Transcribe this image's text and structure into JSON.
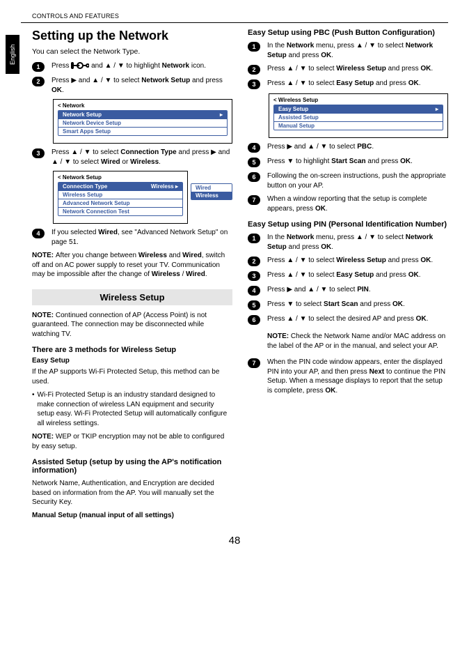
{
  "header": "CONTROLS AND FEATURES",
  "lang": "English",
  "page_number": "48",
  "left": {
    "title": "Setting up the Network",
    "intro": "You can select the Network Type.",
    "step1_a": "Press ",
    "step1_b": " and ▲ / ▼ to highlight ",
    "step1_bold1": "Network",
    "step1_c": " icon.",
    "step2_a": "Press ▶ and ▲ / ▼ to select ",
    "step2_bold1": "Network Setup",
    "step2_b": " and press ",
    "step2_bold2": "OK",
    "step2_c": ".",
    "menu1_title": "< Network",
    "menu1_row1": "Network Setup",
    "menu1_row2": "Network Device Setup",
    "menu1_row3": "Smart Apps Setup",
    "step3_a": "Press ▲ / ▼ to select ",
    "step3_bold1": "Connection Type",
    "step3_b": " and press ▶ and ▲ / ▼ to select ",
    "step3_bold2": "Wired",
    "step3_c": " or ",
    "step3_bold3": "Wireless",
    "step3_d": ".",
    "menu2_title": "< Network Setup",
    "menu2_row1_label": "Connection Type",
    "menu2_row1_value": "Wireless",
    "menu2_row2": "Wireless Setup",
    "menu2_row3": "Advanced Network Setup",
    "menu2_row4": "Network Connection Test",
    "popup_row1": "Wired",
    "popup_row2": "Wireless",
    "step4_a": "If you selected ",
    "step4_bold1": "Wired",
    "step4_b": ", see \"Advanced Network Setup\" on page 51.",
    "note1_label": "NOTE:  ",
    "note1_a": "After you change between ",
    "note1_bold1": "Wireless",
    "note1_b": " and ",
    "note1_bold2": "Wired",
    "note1_c": ", switch off and on AC power supply to reset your TV. Communication may be impossible after the change of ",
    "note1_bold3": "Wireless",
    "note1_d": " / ",
    "note1_bold4": "Wired",
    "note1_e": ".",
    "wireless_head": "Wireless Setup",
    "note2_label": "NOTE:",
    "note2_text": " Continued connection of AP (Access Point) is not guaranteed. The connection may be disconnected while watching TV.",
    "methods_head": "There are 3 methods for Wireless Setup",
    "easy_label": "Easy Setup",
    "easy_text": "If the AP supports Wi-Fi Protected Setup, this method can be used.",
    "easy_bullet": "Wi-Fi Protected Setup is an industry standard designed to make connection of wireless LAN equipment and security setup easy. Wi-Fi Protected Setup will automatically configure all wireless settings.",
    "note3_label": "NOTE:  ",
    "note3_text": "WEP or TKIP encryption may not be able to configured by easy setup.",
    "assisted_head": "Assisted Setup (setup by using the AP's notification information)",
    "assisted_text": "Network Name, Authentication, and Encryption are decided based on information from the AP. You will manually set the Security Key.",
    "manual_head": "Manual Setup (manual input of all settings)"
  },
  "right": {
    "pbc_head": "Easy Setup using PBC (Push Button Configuration)",
    "r1_step1_a": "In the ",
    "r1_step1_bold1": "Network",
    "r1_step1_b": " menu, press ▲ / ▼ to select ",
    "r1_step1_bold2": "Network Setup",
    "r1_step1_c": " and press ",
    "r1_step1_bold3": "OK",
    "r1_step1_d": ".",
    "r1_step2_a": "Press ▲ / ▼ to select ",
    "r1_step2_bold1": "Wireless Setup",
    "r1_step2_b": " and press ",
    "r1_step2_bold2": "OK",
    "r1_step2_c": ".",
    "r1_step3_a": "Press ▲ / ▼ to select ",
    "r1_step3_bold1": "Easy Setup",
    "r1_step3_b": " and press ",
    "r1_step3_bold2": "OK",
    "r1_step3_c": ".",
    "menu3_title": "< Wireless Setup",
    "menu3_row1": "Easy Setup",
    "menu3_row2": "Assisted Setup",
    "menu3_row3": "Manual Setup",
    "r1_step4_a": "Press ▶ and ▲ / ▼ to select ",
    "r1_step4_bold1": "PBC",
    "r1_step4_b": ".",
    "r1_step5_a": "Press ▼ to highlight ",
    "r1_step5_bold1": "Start Scan",
    "r1_step5_b": " and press ",
    "r1_step5_bold2": "OK",
    "r1_step5_c": ".",
    "r1_step6": "Following the on-screen instructions, push the appropriate button on your AP.",
    "r1_step7_a": "When a window reporting that the setup is complete appears, press ",
    "r1_step7_bold1": "OK",
    "r1_step7_b": ".",
    "pin_head": "Easy Setup using PIN (Personal Identification Number)",
    "r2_step1_a": "In the ",
    "r2_step1_bold1": "Network",
    "r2_step1_b": " menu, press ▲ / ▼ to select ",
    "r2_step1_bold2": "Network Setup",
    "r2_step1_c": " and press ",
    "r2_step1_bold3": "OK",
    "r2_step1_d": ".",
    "r2_step2_a": "Press ▲ / ▼ to select ",
    "r2_step2_bold1": "Wireless Setup",
    "r2_step2_b": " and press ",
    "r2_step2_bold2": "OK",
    "r2_step2_c": ".",
    "r2_step3_a": "Press ▲ / ▼ to select ",
    "r2_step3_bold1": "Easy Setup",
    "r2_step3_b": " and press ",
    "r2_step3_bold2": "OK",
    "r2_step3_c": ".",
    "r2_step4_a": "Press ▶ and ▲ / ▼ to select ",
    "r2_step4_bold1": "PIN",
    "r2_step4_b": ".",
    "r2_step5_a": "Press ▼ to select ",
    "r2_step5_bold1": "Start Scan",
    "r2_step5_b": " and press ",
    "r2_step5_bold2": "OK",
    "r2_step5_c": ".",
    "r2_step6_a": "Press ▲ / ▼ to select the desired AP and press ",
    "r2_step6_bold1": "OK",
    "r2_step6_b": ".",
    "r2_step6_note_label": "NOTE:",
    "r2_step6_note": " Check the Network Name and/or MAC address on the label of the AP or in the manual, and select your AP.",
    "r2_step7_a": "When the PIN code window appears, enter the displayed PIN into your AP, and then press ",
    "r2_step7_bold1": "Next",
    "r2_step7_b": " to continue the PIN Setup. When a message displays to report that the setup is complete, press ",
    "r2_step7_bold2": "OK",
    "r2_step7_c": "."
  }
}
